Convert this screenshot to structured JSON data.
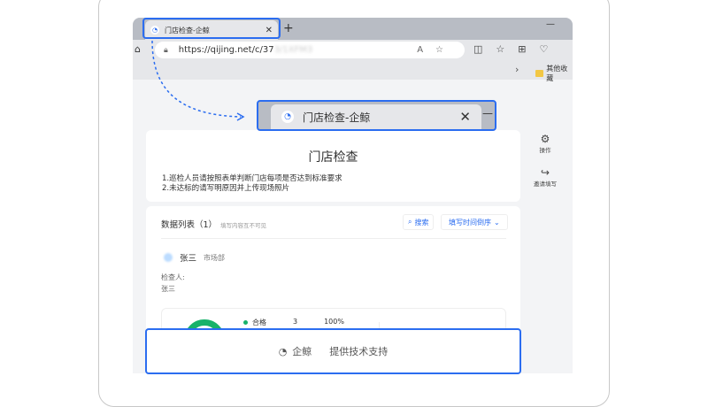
{
  "browser": {
    "tab_title": "门店检查-企鲸",
    "url_visible": "https://qijing.net/c/37",
    "url_blurred": "3/1XFM3",
    "bookmark_folder": "其他收藏"
  },
  "page": {
    "title": "门店检查",
    "instructions": [
      "1.巡检人员请按照表单判断门店每项是否达到标准要求",
      "2.未达标的请写明原因并上传现场照片"
    ]
  },
  "list": {
    "title": "数据列表（1）",
    "hint": "填写内容互不可见",
    "search_label": "搜索",
    "sort_label": "填写时间倒序"
  },
  "entry": {
    "name": "张三",
    "department": "市场部",
    "inspector_label": "检查人:",
    "inspector_value": "张三",
    "stat_label": "合格",
    "stat_count": "3",
    "stat_percent": "100%"
  },
  "side": {
    "actions_label": "操作",
    "invite_label": "邀请填写"
  },
  "footer": {
    "brand": "企鲸",
    "support": "提供技术支持"
  },
  "colors": {
    "accent": "#2b6df0",
    "success": "#17b26a"
  }
}
